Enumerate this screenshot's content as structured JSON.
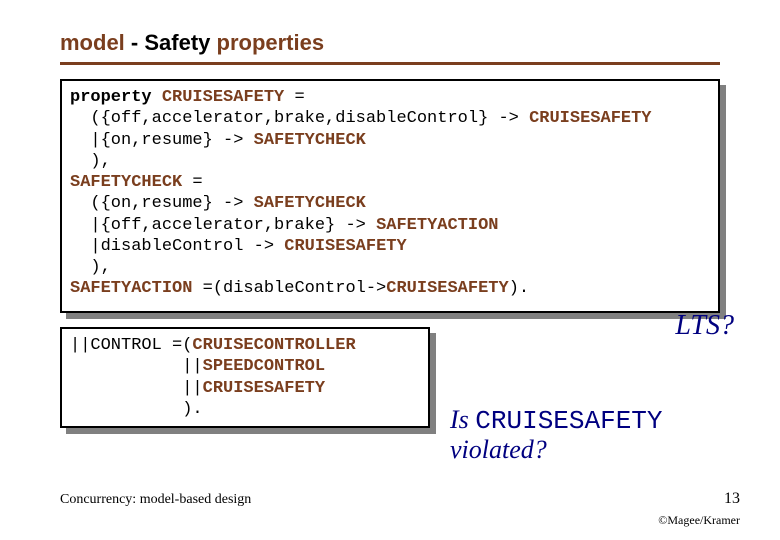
{
  "title": {
    "brown1": "model ",
    "black": " - Safety",
    "brown2": " properties"
  },
  "code1": {
    "l1a": "property ",
    "l1b": "CRUISESAFETY",
    "l1c": " =",
    "l2a": "  ({off,accelerator,brake,disableControl} -> ",
    "l2b": "CRUISESAFETY",
    "l3a": "  |{on,resume} -> ",
    "l3b": "SAFETYCHECK",
    "l4": "  ),",
    "l5a": "SAFETYCHECK",
    "l5b": " =",
    "l6a": "  ({on,resume} -> ",
    "l6b": "SAFETYCHECK",
    "l7a": "  |{off,accelerator,brake} -> ",
    "l7b": "SAFETYACTION",
    "l8a": "  |disableControl -> ",
    "l8b": "CRUISESAFETY",
    "l9": "  ),",
    "l10a": "SAFETYACTION",
    "l10b": " =(disableControl->",
    "l10c": "CRUISESAFETY",
    "l10d": ")."
  },
  "code2": {
    "l1a": "||CONTROL =(",
    "l1b": "CRUISECONTROLLER",
    "l2a": "           ||",
    "l2b": "SPEEDCONTROL",
    "l3a": "           ||",
    "l3b": "CRUISESAFETY",
    "l4": "           )."
  },
  "lts": "LTS?",
  "question": {
    "pre": "Is ",
    "mono": "CRUISESAFETY",
    "post": "violated?"
  },
  "footer": {
    "left": "Concurrency: model-based design",
    "num": "13",
    "credit": "©Magee/Kramer"
  }
}
